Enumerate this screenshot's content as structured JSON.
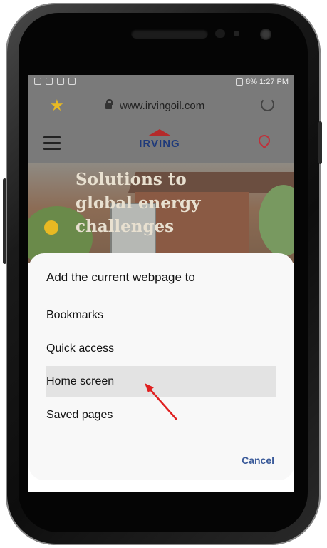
{
  "statusbar": {
    "right_text": "8% 1:27 PM"
  },
  "browser": {
    "url": "www.irvingoil.com"
  },
  "site": {
    "logo": "IRVING",
    "hero_text": "Solutions to\nglobal energy\nchallenges"
  },
  "dialog": {
    "title": "Add the current webpage to",
    "options": [
      {
        "label": "Bookmarks"
      },
      {
        "label": "Quick access"
      },
      {
        "label": "Home screen"
      },
      {
        "label": "Saved pages"
      }
    ],
    "cancel_label": "Cancel"
  },
  "colors": {
    "accent": "#3b5b9a",
    "star": "#e8b923",
    "arrow": "#e02020"
  }
}
